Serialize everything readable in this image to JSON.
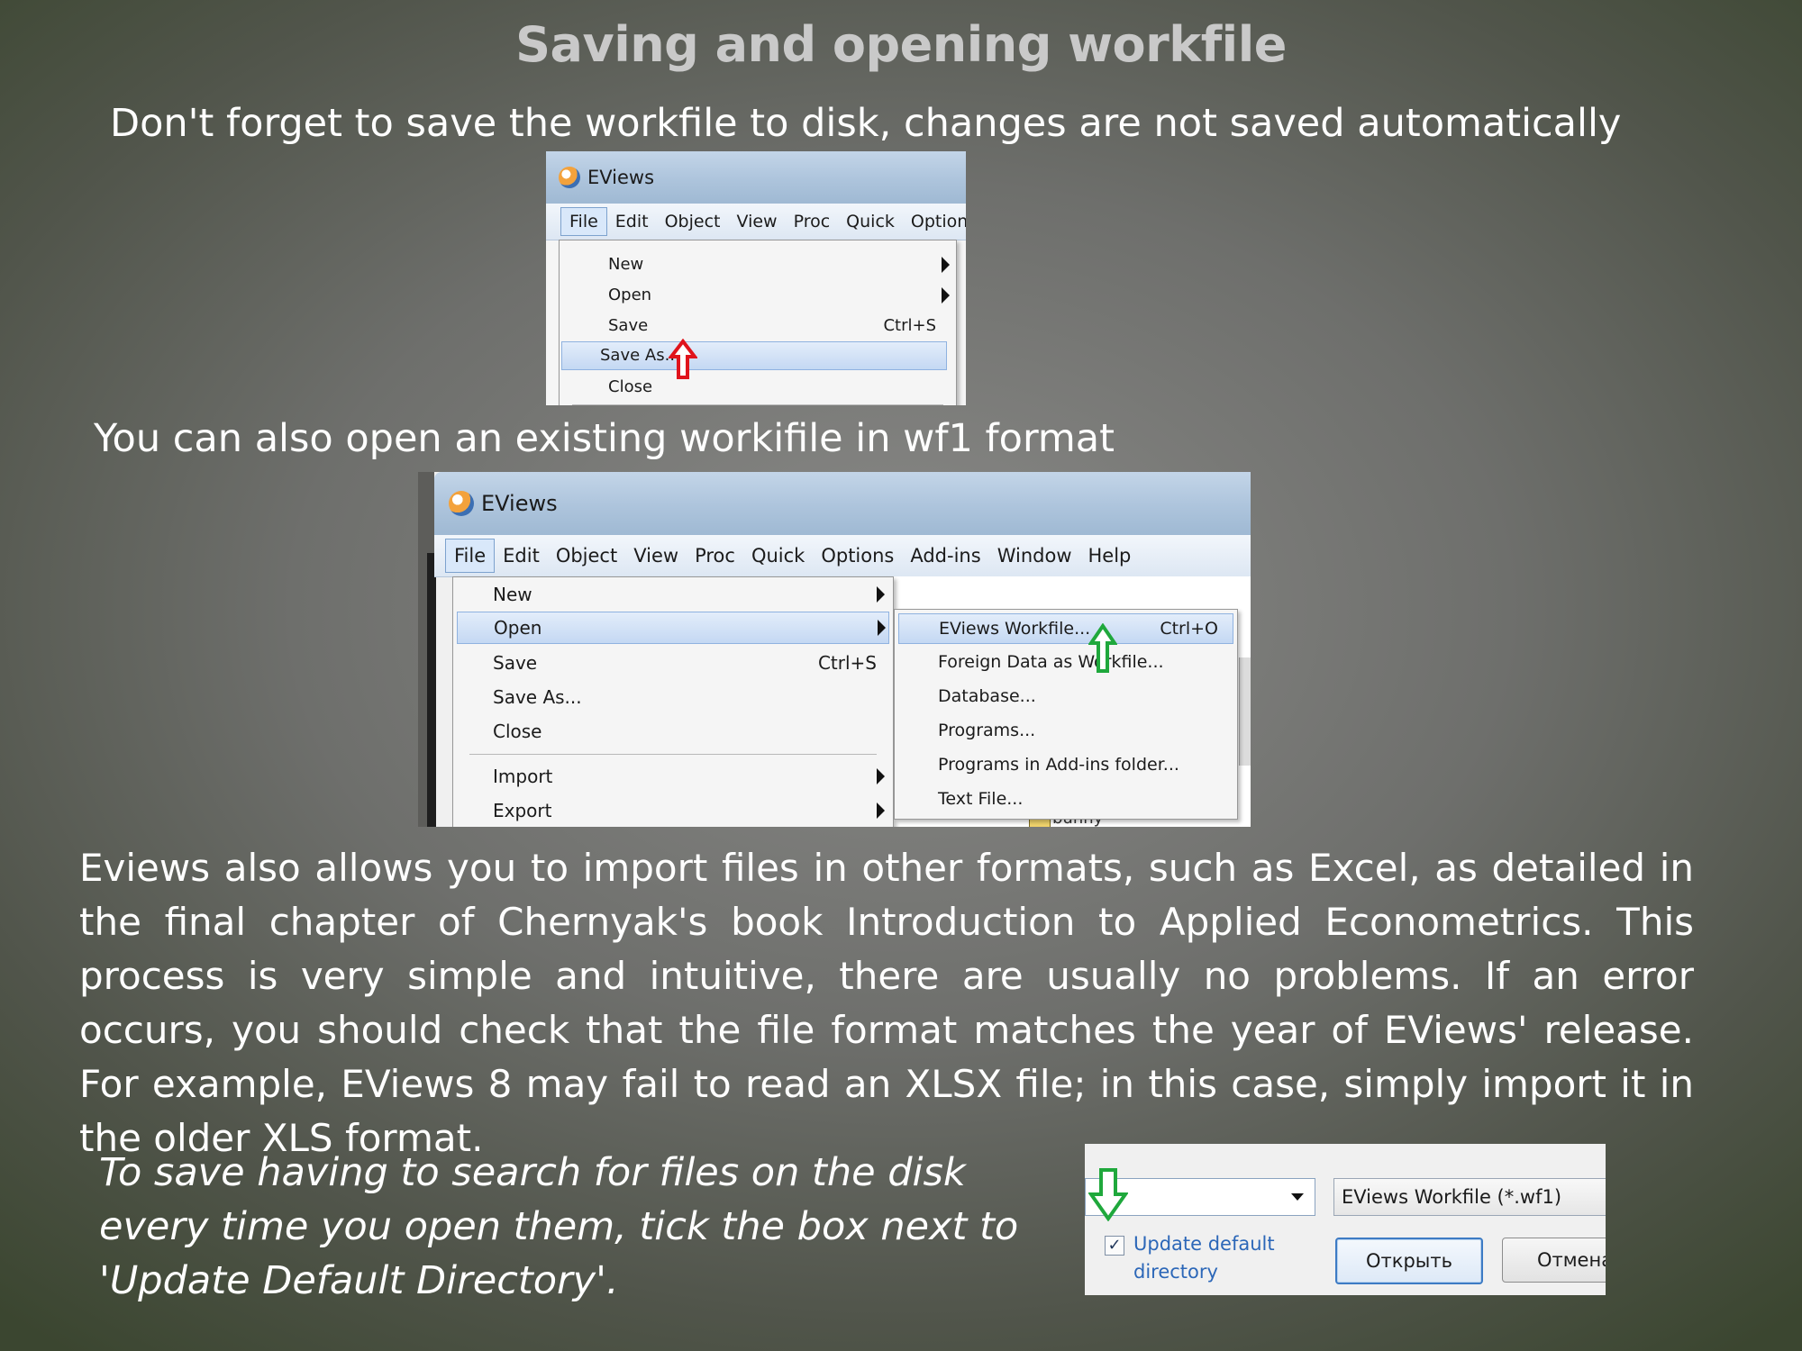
{
  "title": "Saving and opening workfile",
  "line1": "Don't forget to save the workfile to disk, changes are not saved automatically",
  "line2": "You can also open an existing workifile in wf1 format",
  "paragraph": "Eviews also allows you to import files in other formats, such as Excel, as detailed in the final chapter of Chernyak's book Introduction to Applied Econometrics. This process is very simple and intuitive, there are usually no problems. If an error occurs, you should check that the file format matches the year of EViews' release. For example, EViews 8 may fail to read an XLSX file; in this case, simply import it in the older XLS format.",
  "tip": "To save having to search for files on the disk every time you open them, tick the box next to 'Update Default Directory'.",
  "shot1": {
    "window_title": "EViews",
    "menubar": [
      "File",
      "Edit",
      "Object",
      "View",
      "Proc",
      "Quick",
      "Options"
    ],
    "menu": [
      {
        "label": "New",
        "submenu": true
      },
      {
        "label": "Open",
        "submenu": true
      },
      {
        "label": "Save",
        "shortcut": "Ctrl+S"
      },
      {
        "label": "Save As...",
        "highlighted": true
      },
      {
        "label": "Close"
      }
    ],
    "pointer_color": "#e0141c"
  },
  "shot2": {
    "window_title": "EViews",
    "menubar": [
      "File",
      "Edit",
      "Object",
      "View",
      "Proc",
      "Quick",
      "Options",
      "Add-ins",
      "Window",
      "Help"
    ],
    "menu": [
      {
        "label": "New",
        "submenu": true
      },
      {
        "label": "Open",
        "submenu": true,
        "highlighted": true
      },
      {
        "label": "Save",
        "shortcut": "Ctrl+S"
      },
      {
        "label": "Save As..."
      },
      {
        "label": "Close"
      },
      {
        "label": "Import",
        "submenu": true
      },
      {
        "label": "Export",
        "submenu": true
      }
    ],
    "submenu": [
      {
        "label": "EViews Workfile...",
        "shortcut": "Ctrl+O",
        "highlighted": true
      },
      {
        "label": "Foreign Data as Workfile..."
      },
      {
        "label": "Database..."
      },
      {
        "label": "Programs..."
      },
      {
        "label": "Programs in Add-ins folder..."
      },
      {
        "label": "Text File..."
      }
    ],
    "background_item": "bunny",
    "pointer_color": "#1fa83c"
  },
  "shot3": {
    "file_type": "EViews Workfile (*.wf1)",
    "checkbox_label_line1": "Update default",
    "checkbox_label_line2": "directory",
    "checkbox_checked": true,
    "open_button": "Открыть",
    "cancel_button": "Отмена",
    "pointer_color": "#1fa83c"
  }
}
